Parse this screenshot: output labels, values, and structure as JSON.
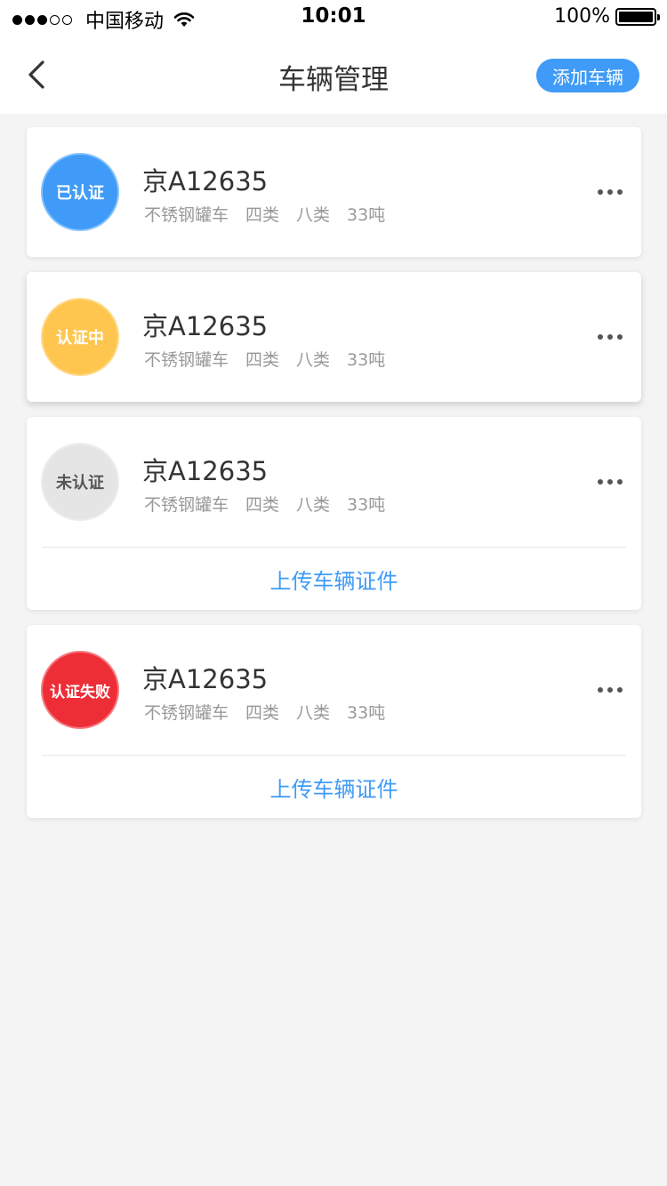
{
  "status_bar": {
    "carrier": "中国移动",
    "time": "10:01",
    "battery": "100%",
    "signal_bars_filled": 3,
    "signal_bars_total": 5
  },
  "nav": {
    "title": "车辆管理",
    "add_button": "添加车辆",
    "back_icon": "chevron-left-icon"
  },
  "colors": {
    "accent": "#3f9bf7",
    "verified": "#3f9bf7",
    "pending": "#fec64e",
    "unverified": "#e5e5e5",
    "failed": "#ee2e37"
  },
  "vehicles": [
    {
      "status": "已认证",
      "plate": "京A12635",
      "type": "不锈钢罐车",
      "class1": "四类",
      "class2": "八类",
      "weight": "33吨"
    },
    {
      "status": "认证中",
      "plate": "京A12635",
      "type": "不锈钢罐车",
      "class1": "四类",
      "class2": "八类",
      "weight": "33吨"
    },
    {
      "status": "未认证",
      "plate": "京A12635",
      "type": "不锈钢罐车",
      "class1": "四类",
      "class2": "八类",
      "weight": "33吨",
      "action": "上传车辆证件"
    },
    {
      "status": "认证失败",
      "plate": "京A12635",
      "type": "不锈钢罐车",
      "class1": "四类",
      "class2": "八类",
      "weight": "33吨",
      "action": "上传车辆证件"
    }
  ]
}
